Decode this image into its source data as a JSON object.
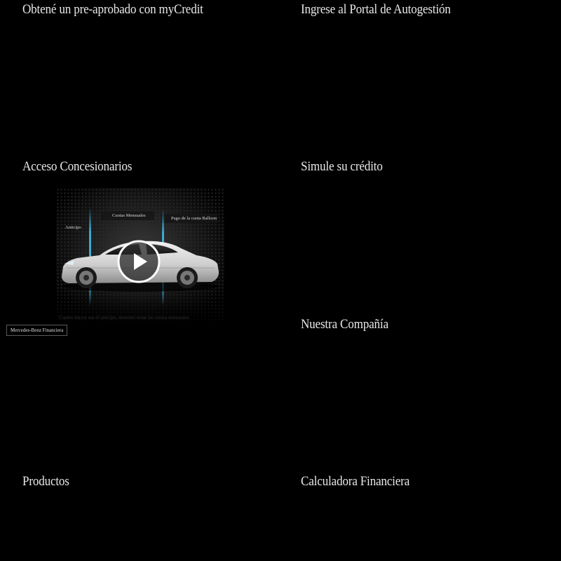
{
  "tiles": {
    "precredit": "Obtené un pre-aprobado con myCredit",
    "portal": "Ingrese al Portal de Autogestión",
    "dealers": "Acceso Concesionarios",
    "simulator": "Simule su crédito",
    "company": "Nuestra Compañía",
    "products": "Productos",
    "calculator": "Calculadora Financiera"
  },
  "video": {
    "label_monthly": "Cuotas Mensuales",
    "label_advance": "Anticipo",
    "label_balloon": "Pago de la cuota Balloon",
    "caption": "Cuanto mayor sea el anticipo, menores serán las cuotas mensuales.",
    "brand": "Mercedes-Benz Financiera",
    "play_icon": "play-icon"
  },
  "colors": {
    "background": "#000000",
    "text": "#e9e9e9",
    "accent_line": "#3fb8e6"
  }
}
